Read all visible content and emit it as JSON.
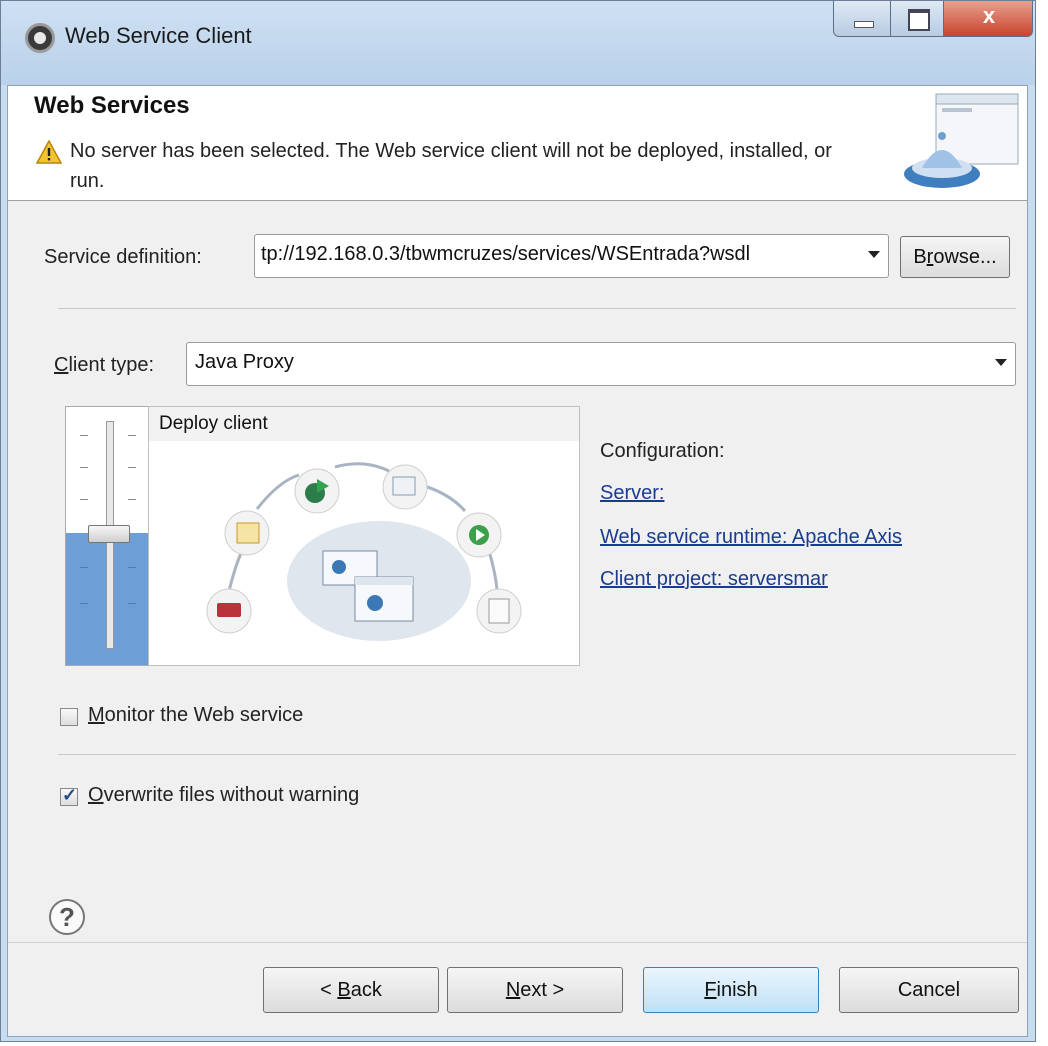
{
  "window": {
    "title": "Web Service Client",
    "close_glyph": "x"
  },
  "banner": {
    "title": "Web Services",
    "message": "No server has been selected. The Web service client will not be deployed, installed, or run."
  },
  "service": {
    "label": "Service definition:",
    "value": "tp://192.168.0.3/tbwmcruzes/services/WSEntrada?wsdl",
    "browse": {
      "pre": "B",
      "ul": "r",
      "post": "owse..."
    }
  },
  "client_type": {
    "label_ul": "C",
    "label_rest": "lient type:",
    "value": "Java Proxy"
  },
  "slider": {
    "preview_label": "Deploy  client"
  },
  "configuration": {
    "heading": "Configuration:",
    "server": "Server: ",
    "runtime": "Web service runtime: Apache Axis",
    "project": "Client project: serversmar"
  },
  "options": {
    "monitor": {
      "ul": "M",
      "rest": "onitor the Web service",
      "checked": false
    },
    "overwrite": {
      "ul": "O",
      "rest": "verwrite files without warning",
      "checked": true
    }
  },
  "buttons": {
    "help": "?",
    "back": {
      "pre": "< ",
      "ul": "B",
      "post": "ack"
    },
    "next": {
      "ul": "N",
      "post": "ext >"
    },
    "finish": {
      "ul": "F",
      "post": "inish"
    },
    "cancel": "Cancel"
  },
  "colors": {
    "link": "#1a3c8f",
    "slider_fill": "#6d9fd6",
    "title_bar": "#c4d8ee"
  }
}
